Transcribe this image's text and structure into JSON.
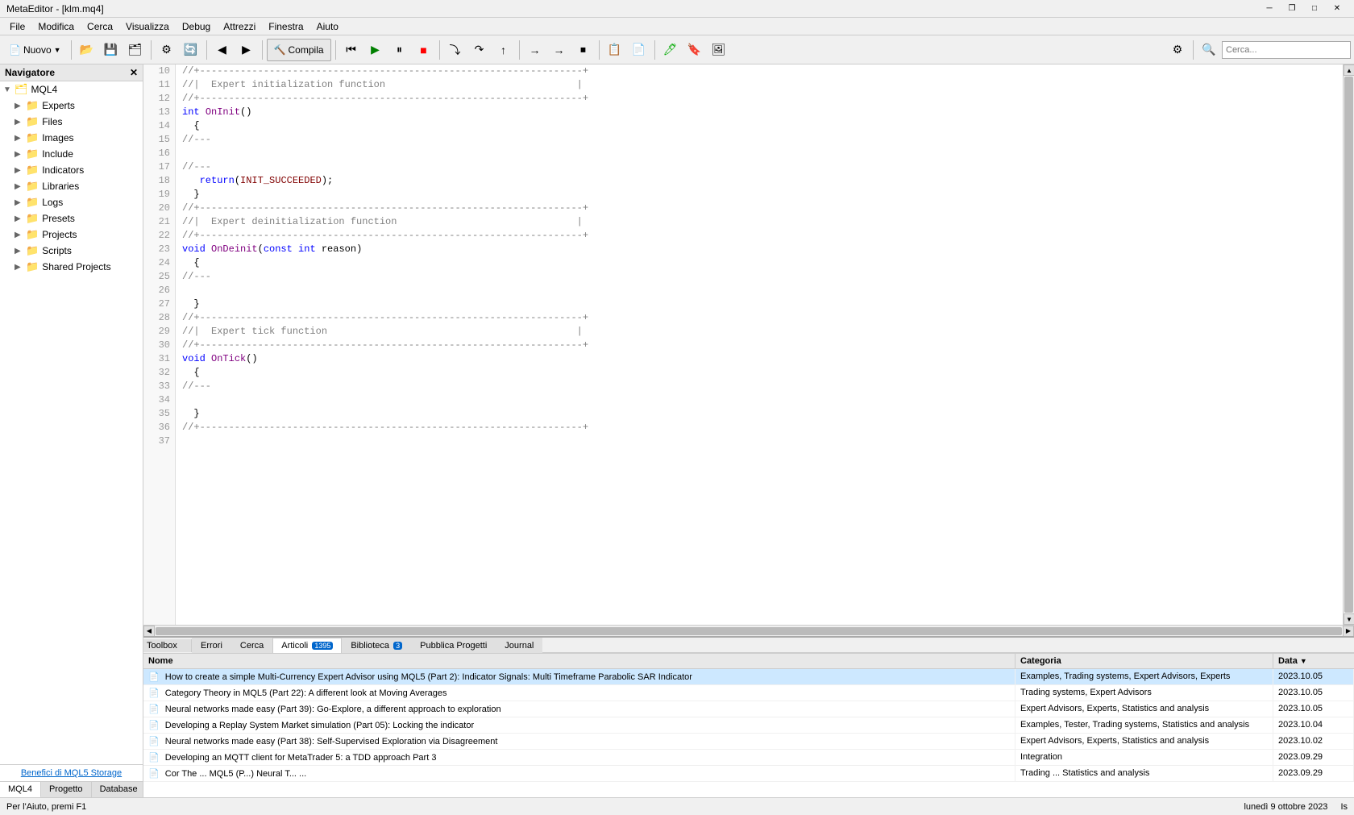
{
  "window": {
    "title": "MetaEditor - [klm.mq4]",
    "controls": {
      "minimize": "─",
      "maximize": "□",
      "close": "✕",
      "restore": "❐"
    }
  },
  "menubar": {
    "items": [
      "File",
      "Modifica",
      "Cerca",
      "Visualizza",
      "Debug",
      "Attrezzi",
      "Finestra",
      "Aiuto"
    ]
  },
  "toolbar": {
    "new_label": "Nuovo",
    "compile_label": "Compila"
  },
  "navigator": {
    "title": "Navigatore",
    "tree": [
      {
        "label": "MQL4",
        "level": 0,
        "type": "root",
        "expanded": true
      },
      {
        "label": "Experts",
        "level": 1,
        "type": "folder"
      },
      {
        "label": "Files",
        "level": 1,
        "type": "folder"
      },
      {
        "label": "Images",
        "level": 1,
        "type": "folder"
      },
      {
        "label": "Include",
        "level": 1,
        "type": "folder"
      },
      {
        "label": "Indicators",
        "level": 1,
        "type": "folder"
      },
      {
        "label": "Libraries",
        "level": 1,
        "type": "folder"
      },
      {
        "label": "Logs",
        "level": 1,
        "type": "folder"
      },
      {
        "label": "Presets",
        "level": 1,
        "type": "folder"
      },
      {
        "label": "Projects",
        "level": 1,
        "type": "folder"
      },
      {
        "label": "Scripts",
        "level": 1,
        "type": "folder"
      },
      {
        "label": "Shared Projects",
        "level": 1,
        "type": "folder-special"
      }
    ],
    "bottom_link": "Benefici di MQL5 Storage",
    "tabs": [
      "MQL4",
      "Progetto",
      "Database"
    ]
  },
  "code": {
    "lines": [
      {
        "num": 10,
        "content": "//+------------------------------------------------------------------+"
      },
      {
        "num": 11,
        "content": "//|  Expert initialization function                                 |"
      },
      {
        "num": 12,
        "content": "//+------------------------------------------------------------------+"
      },
      {
        "num": 13,
        "content": "int OnInit()",
        "highlight": true
      },
      {
        "num": 14,
        "content": "  {"
      },
      {
        "num": 15,
        "content": "//---"
      },
      {
        "num": 16,
        "content": ""
      },
      {
        "num": 17,
        "content": "//---"
      },
      {
        "num": 18,
        "content": "   return(INIT_SUCCEEDED);"
      },
      {
        "num": 19,
        "content": "  }"
      },
      {
        "num": 20,
        "content": "//+------------------------------------------------------------------+"
      },
      {
        "num": 21,
        "content": "//|  Expert deinitialization function                               |"
      },
      {
        "num": 22,
        "content": "//+------------------------------------------------------------------+"
      },
      {
        "num": 23,
        "content": "void OnDeinit(const int reason)",
        "highlight": true
      },
      {
        "num": 24,
        "content": "  {"
      },
      {
        "num": 25,
        "content": "//---"
      },
      {
        "num": 26,
        "content": ""
      },
      {
        "num": 27,
        "content": "  }"
      },
      {
        "num": 28,
        "content": "//+------------------------------------------------------------------+"
      },
      {
        "num": 29,
        "content": "//|  Expert tick function                                           |"
      },
      {
        "num": 30,
        "content": "//+------------------------------------------------------------------+"
      },
      {
        "num": 31,
        "content": "void OnTick()",
        "highlight": true
      },
      {
        "num": 32,
        "content": "  {"
      },
      {
        "num": 33,
        "content": "//---"
      },
      {
        "num": 34,
        "content": ""
      },
      {
        "num": 35,
        "content": "  }"
      },
      {
        "num": 36,
        "content": "//+------------------------------------------------------------------+"
      },
      {
        "num": 37,
        "content": ""
      }
    ]
  },
  "bottom_panel": {
    "tabs": [
      {
        "label": "Errori",
        "badge": null
      },
      {
        "label": "Cerca",
        "badge": null
      },
      {
        "label": "Articoli",
        "badge": "1395",
        "active": true
      },
      {
        "label": "Biblioteca",
        "badge": "3"
      },
      {
        "label": "Pubblica Progetti",
        "badge": null
      },
      {
        "label": "Journal",
        "badge": null
      }
    ],
    "articles": {
      "headers": [
        "Nome",
        "Categoria",
        "Data"
      ],
      "rows": [
        {
          "name": "How to create a simple Multi-Currency Expert Advisor using MQL5 (Part 2): Indicator Signals: Multi Timeframe Parabolic SAR Indicator",
          "category": "Examples, Trading systems, Expert Advisors, Experts",
          "date": "2023.10.05",
          "selected": true
        },
        {
          "name": "Category Theory in MQL5 (Part 22): A different look at Moving Averages",
          "category": "Trading systems, Expert Advisors",
          "date": "2023.10.05",
          "selected": false
        },
        {
          "name": "Neural networks made easy (Part 39): Go-Explore, a different approach to exploration",
          "category": "Expert Advisors, Experts, Statistics and analysis",
          "date": "2023.10.05",
          "selected": false
        },
        {
          "name": "Developing a Replay System  Market simulation (Part 05): Locking the indicator",
          "category": "Examples, Tester, Trading systems, Statistics and analysis",
          "date": "2023.10.04",
          "selected": false
        },
        {
          "name": "Neural networks made easy (Part 38): Self-Supervised Exploration via Disagreement",
          "category": "Expert Advisors, Experts, Statistics and analysis",
          "date": "2023.10.02",
          "selected": false
        },
        {
          "name": "Developing an MQTT client for MetaTrader 5: a TDD approach  Part 3",
          "category": "Integration",
          "date": "2023.09.29",
          "selected": false
        },
        {
          "name": "...",
          "category": "...",
          "date": "2023.09.29",
          "selected": false
        }
      ]
    }
  },
  "statusbar": {
    "help_text": "Per l'Aiuto, premi F1",
    "date_text": "lunedì 9 ottobre 2023",
    "indicator": "Is"
  },
  "toolbox_label": "Toolbox"
}
